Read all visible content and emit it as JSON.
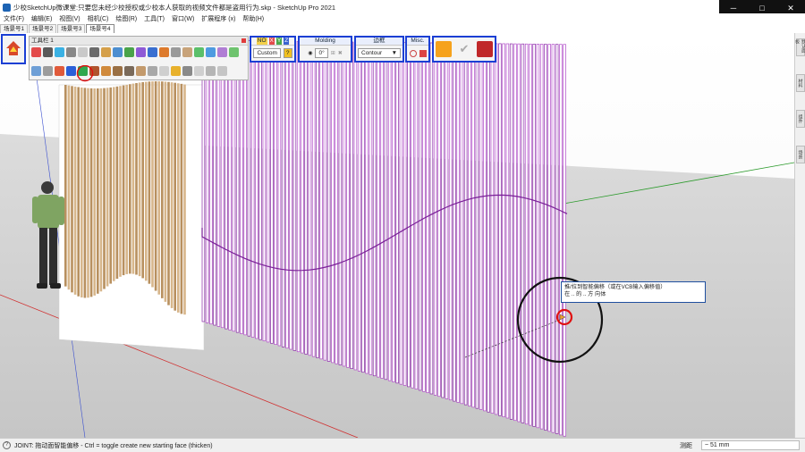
{
  "window": {
    "title": "少校SketchUp微课堂:只要您未经少校授权或少校本人获取的视频文件都是盗用行为.skp - SketchUp Pro 2021",
    "controls": [
      "─",
      "□",
      "✕"
    ]
  },
  "menu": [
    "文件(F)",
    "编辑(E)",
    "视图(V)",
    "相机(C)",
    "绘图(R)",
    "工具(T)",
    "窗口(W)",
    "扩展程序 (x)",
    "帮助(H)"
  ],
  "scenes": [
    "场景号1",
    "场景号2",
    "场景号3",
    "场景号4"
  ],
  "active_scene_index": 3,
  "toolbar_panel": {
    "title": "工具栏 1"
  },
  "axis_box": {
    "head_labels": [
      "NO",
      "X",
      "Y",
      "Z"
    ],
    "value": "Custom",
    "lock_symbol": "?"
  },
  "molding_box": {
    "head": "Molding",
    "angle": "0°"
  },
  "border_box": {
    "head": "边框",
    "value": "Contour"
  },
  "misc_box": {
    "head": "Misc."
  },
  "right_tray_tabs": [
    "默认面板",
    "材料",
    "组件",
    "场景"
  ],
  "tooltip": {
    "line1": "推/拉到智能偏移（或在VCB输入偏移值）",
    "line2": "在 .. 的 .. 方 向体"
  },
  "status": {
    "icon": "?",
    "text": "JOINT: 拖动面智能偏移 - Ctrl = toggle create new starting face (thicken)",
    "vcb_label": "测距",
    "vcb_value": "~ 51 mm"
  },
  "colors": {
    "selection_frame": "#1b3fd4",
    "slat_purple": "#b04ac8",
    "slat_wood": "#c9a77c",
    "highlight_red": "#e01010"
  }
}
